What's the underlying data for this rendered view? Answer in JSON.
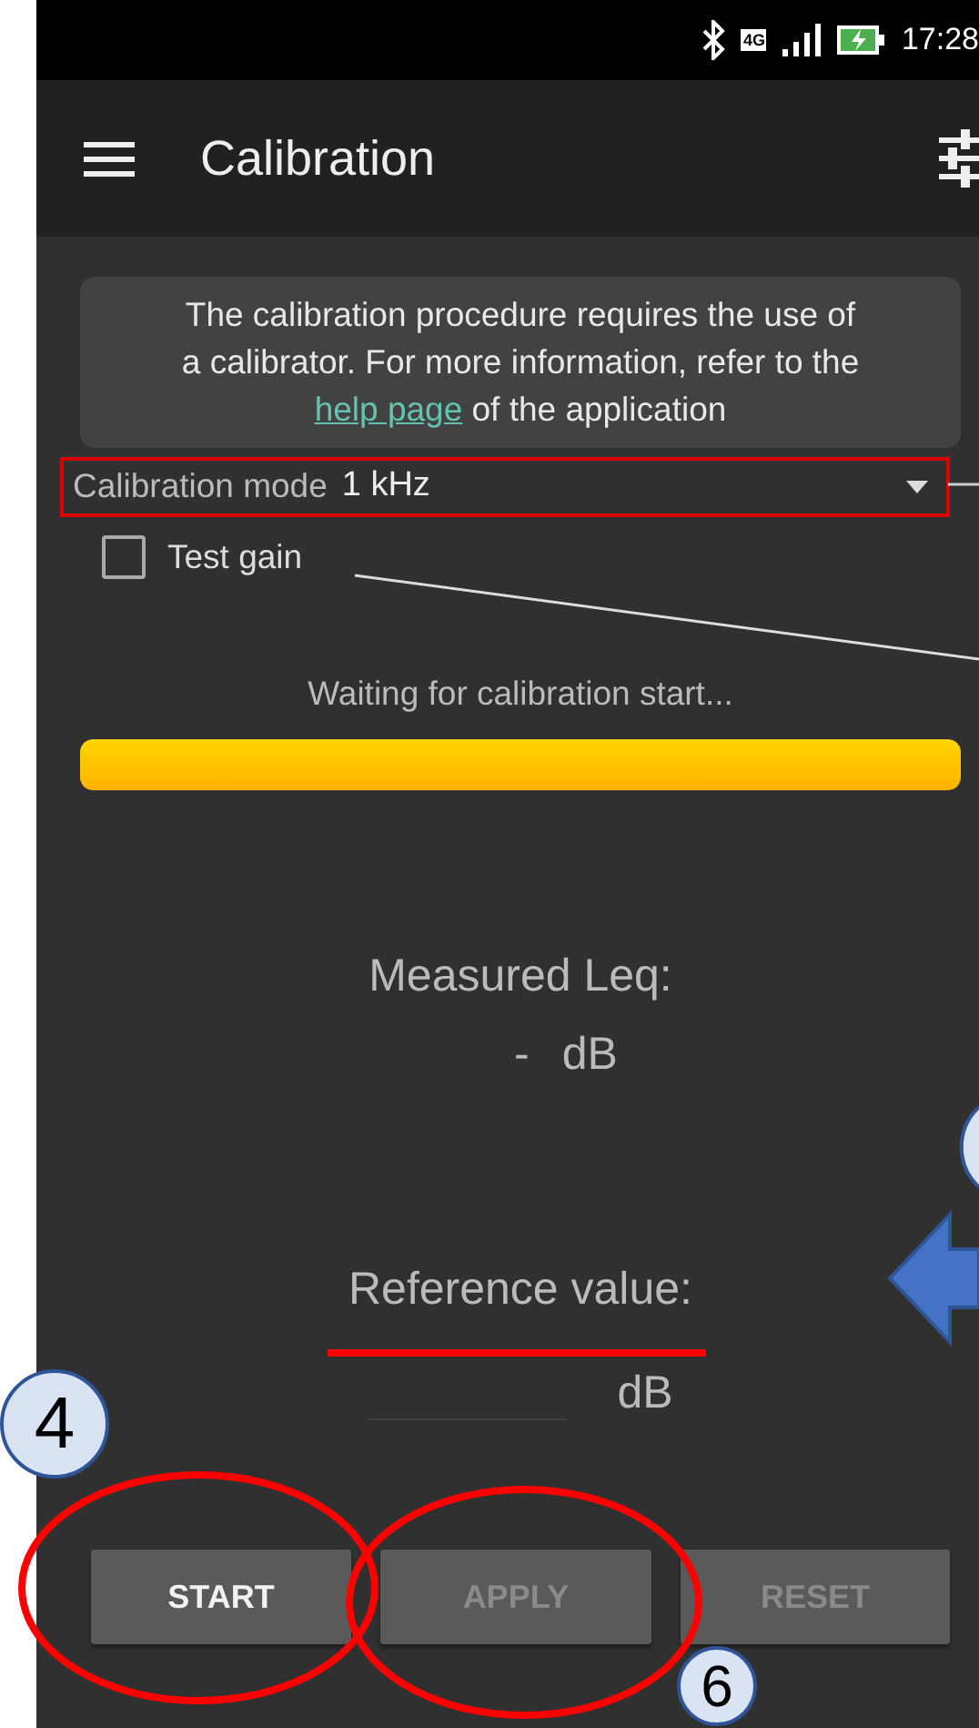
{
  "status_bar": {
    "time": "17:28",
    "network": "4G"
  },
  "app_bar": {
    "title": "Calibration"
  },
  "info": {
    "text": "The calibration procedure requires the use of a calibrator. For more information, refer to the",
    "link": "help page",
    "after": "of the application"
  },
  "mode": {
    "label": "Calibration mode",
    "value": "1 kHz"
  },
  "test_gain": {
    "label": "Test gain",
    "checked": false
  },
  "progress": {
    "status": "Waiting for calibration start...",
    "level": 1
  },
  "measured": {
    "label": "Measured Leq:",
    "value": "-",
    "unit": "dB"
  },
  "reference": {
    "label": "Reference value:",
    "unit": "dB"
  },
  "buttons": [
    {
      "label": "START",
      "disabled": false
    },
    {
      "label": "APPLY",
      "disabled": true
    },
    {
      "label": "RESET",
      "disabled": true
    }
  ],
  "markers": [
    {
      "label": "4"
    },
    {
      "label": "6"
    }
  ]
}
